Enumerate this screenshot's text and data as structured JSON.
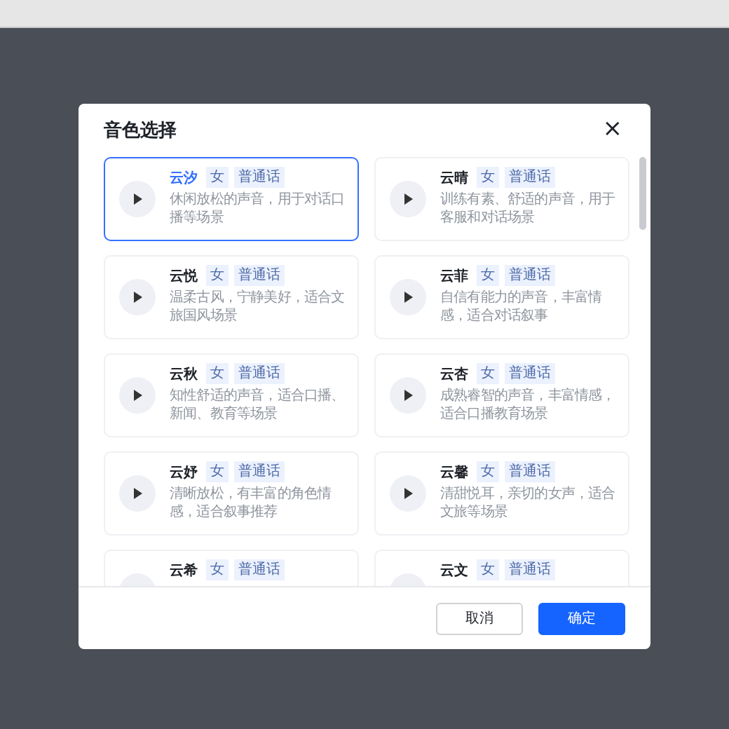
{
  "dialog": {
    "title": "音色选择",
    "close": "×"
  },
  "voices": [
    {
      "name": "云汐",
      "gender": "女",
      "language": "普通话",
      "description": "休闲放松的声音，用于对话口播等场景",
      "selected": true
    },
    {
      "name": "云晴",
      "gender": "女",
      "language": "普通话",
      "description": "训练有素、舒适的声音，用于客服和对话场景",
      "selected": false
    },
    {
      "name": "云悦",
      "gender": "女",
      "language": "普通话",
      "description": "温柔古风，宁静美好，适合文旅国风场景",
      "selected": false
    },
    {
      "name": "云菲",
      "gender": "女",
      "language": "普通话",
      "description": "自信有能力的声音，丰富情感，适合对话叙事",
      "selected": false
    },
    {
      "name": "云秋",
      "gender": "女",
      "language": "普通话",
      "description": "知性舒适的声音，适合口播、新闻、教育等场景",
      "selected": false
    },
    {
      "name": "云杏",
      "gender": "女",
      "language": "普通话",
      "description": "成熟睿智的声音，丰富情感，适合口播教育场景",
      "selected": false
    },
    {
      "name": "云妤",
      "gender": "女",
      "language": "普通话",
      "description": "清晰放松，有丰富的角色情感，适合叙事推荐",
      "selected": false
    },
    {
      "name": "云馨",
      "gender": "女",
      "language": "普通话",
      "description": "清甜悦耳，亲切的女声，适合文旅等场景",
      "selected": false
    },
    {
      "name": "云希",
      "gender": "女",
      "language": "普通话",
      "selected": false
    },
    {
      "name": "云文",
      "gender": "女",
      "language": "普通话",
      "selected": false
    }
  ],
  "buttons": [
    {
      "label": "取消",
      "kind": "secondary"
    },
    {
      "label": "确定",
      "kind": "primary"
    }
  ]
}
